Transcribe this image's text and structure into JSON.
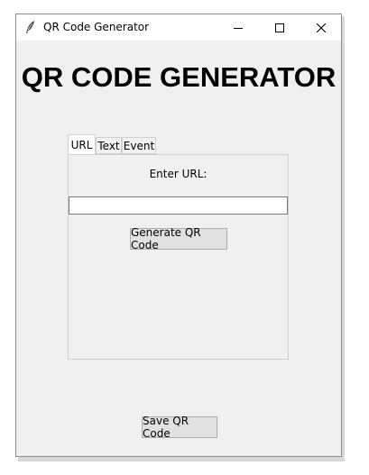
{
  "window": {
    "title": "QR Code Generator",
    "controls": {
      "minimize": "minimize-icon",
      "maximize": "maximize-icon",
      "close": "close-icon"
    }
  },
  "heading": "QR CODE GENERATOR",
  "tabs": [
    {
      "label": "URL",
      "active": true
    },
    {
      "label": "Text",
      "active": false
    },
    {
      "label": "Event",
      "active": false
    }
  ],
  "url_tab": {
    "prompt": "Enter URL:",
    "input_value": "",
    "generate_label": "Generate QR Code"
  },
  "save_label": "Save QR Code"
}
